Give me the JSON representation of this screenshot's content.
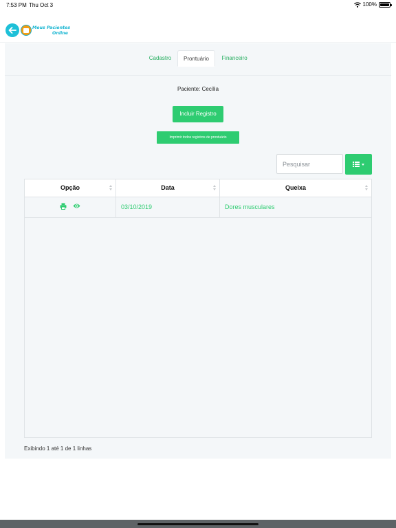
{
  "status_bar": {
    "time": "7:53 PM",
    "date": "Thu Oct 3",
    "battery": "100%",
    "icons": [
      "wifi-icon",
      "battery-icon"
    ]
  },
  "header": {
    "logo_line1": "Meus Pacientes",
    "logo_line2": "Online",
    "icons": [
      "back-arrow-icon",
      "logo-icon"
    ]
  },
  "tabs": [
    {
      "label": "Cadastro",
      "active": false
    },
    {
      "label": "Prontuário",
      "active": true
    },
    {
      "label": "Financeiro",
      "active": false
    }
  ],
  "patient_label": "Paciente: Cecília",
  "buttons": {
    "incluir": "Incluir Registro",
    "imprimir": "Imprimir todos registros de prontuário"
  },
  "search": {
    "placeholder": "Pesquisar",
    "value": ""
  },
  "table": {
    "columns": [
      "Opção",
      "Data",
      "Queixa"
    ],
    "rows": [
      {
        "actions": [
          "print-icon",
          "eye-icon"
        ],
        "data": "03/10/2019",
        "queixa": "Dores musculares"
      }
    ]
  },
  "footer": "Exibindo 1 até 1 de 1 linhas",
  "colors": {
    "accent": "#2ecc71",
    "logo_blue": "#17b5d1",
    "logo_orange": "#f39c12",
    "panel_bg": "#f4f7f9"
  }
}
